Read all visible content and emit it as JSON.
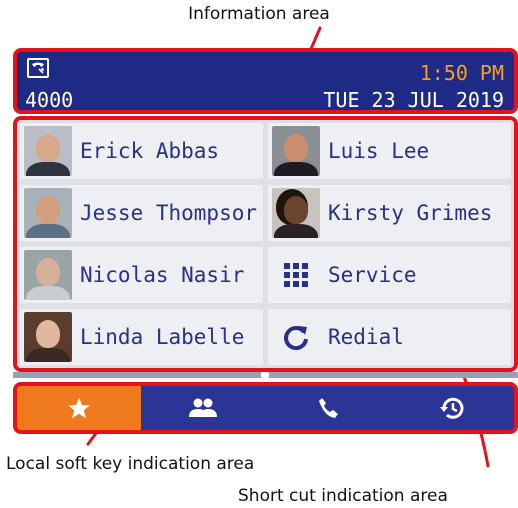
{
  "annotations": {
    "information_area": "Information area",
    "local_soft_key_area": "Local soft key indication area",
    "shortcut_area": "Short cut indication area"
  },
  "info_bar": {
    "extension": "4000",
    "time": "1:50 PM",
    "date": "TUE 23 JUL 2019",
    "phone_icon": "phone-status-icon"
  },
  "shortcuts": [
    {
      "label": "Erick Abbas",
      "type": "contact"
    },
    {
      "label": "Luis Lee",
      "type": "contact"
    },
    {
      "label": "Jesse Thompsor",
      "type": "contact"
    },
    {
      "label": "Kirsty Grimes",
      "type": "contact"
    },
    {
      "label": "Nicolas Nasir",
      "type": "contact"
    },
    {
      "label": "Service",
      "type": "function",
      "icon": "keypad-icon"
    },
    {
      "label": "Linda Labelle",
      "type": "contact"
    },
    {
      "label": "Redial",
      "type": "function",
      "icon": "redial-icon"
    }
  ],
  "softkeys": [
    {
      "icon": "star-icon",
      "active": true
    },
    {
      "icon": "contacts-icon",
      "active": false
    },
    {
      "icon": "phone-icon",
      "active": false
    },
    {
      "icon": "history-icon",
      "active": false
    }
  ],
  "colors": {
    "highlight_border": "#e4131b",
    "bar_blue": "#1f2a86",
    "time_orange": "#f4a21c",
    "active_softkey": "#ee7a1d",
    "label_blue": "#27308a"
  }
}
